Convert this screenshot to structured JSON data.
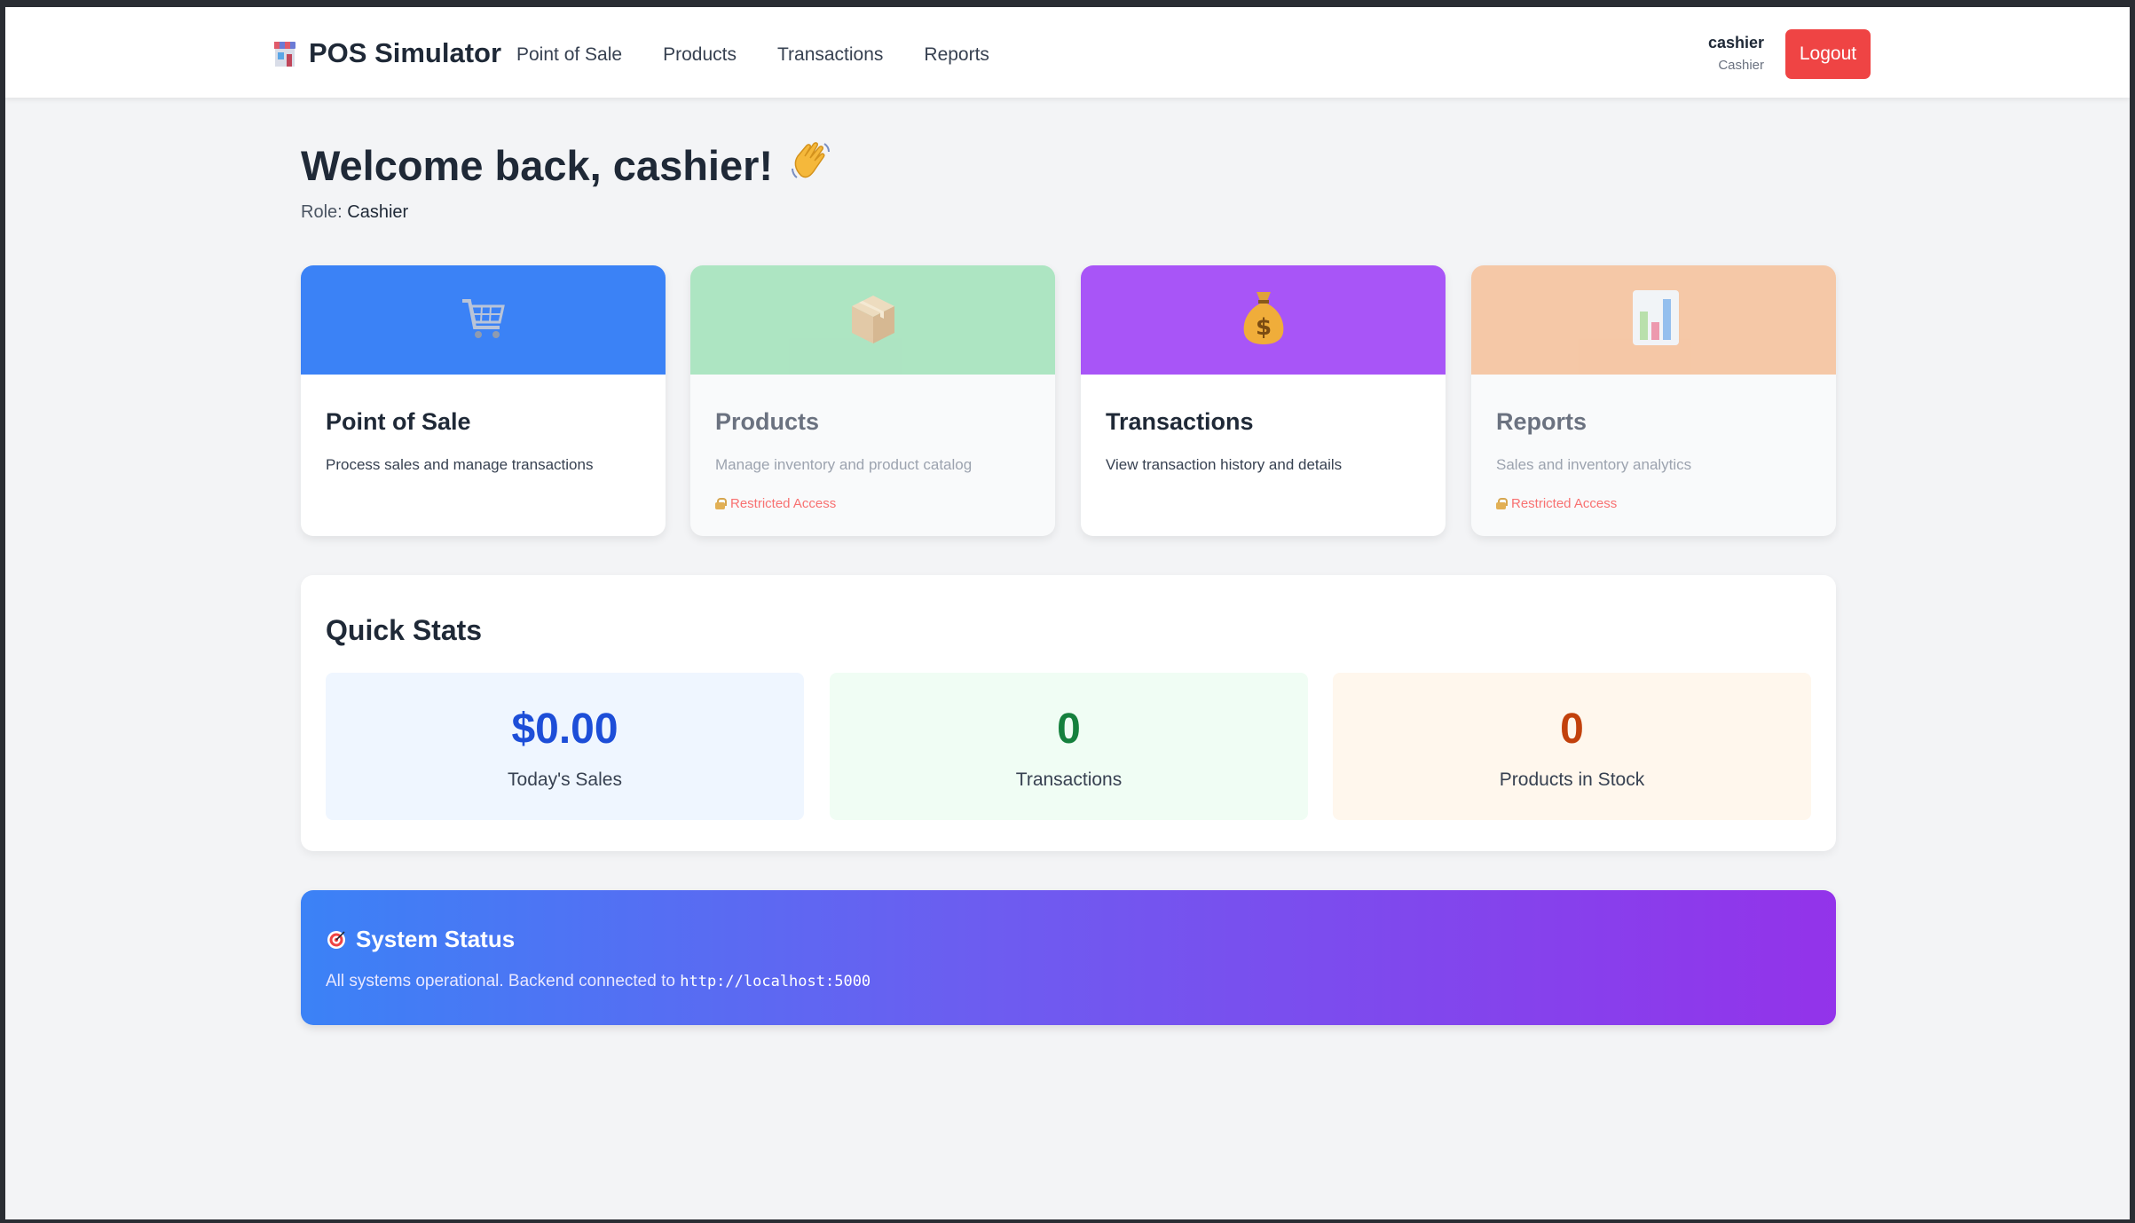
{
  "navbar": {
    "brand_icon": "store-icon",
    "brand": "POS Simulator",
    "links": [
      "Point of Sale",
      "Products",
      "Transactions",
      "Reports"
    ],
    "user_name": "cashier",
    "user_role": "Cashier",
    "logout_label": "Logout"
  },
  "header": {
    "welcome": "Welcome back, cashier!",
    "welcome_icon": "waving-hand-icon",
    "role_label": "Role:",
    "role_value": "Cashier"
  },
  "cards": [
    {
      "title": "Point of Sale",
      "description": "Process sales and manage transactions",
      "icon": "shopping-cart-icon",
      "color": "#3b82f6",
      "restricted": false,
      "restricted_label": ""
    },
    {
      "title": "Products",
      "description": "Manage inventory and product catalog",
      "icon": "package-icon",
      "color": "#8ddcaa",
      "restricted": true,
      "restricted_label": "Restricted Access"
    },
    {
      "title": "Transactions",
      "description": "View transaction history and details",
      "icon": "money-bag-icon",
      "color": "#a855f7",
      "restricted": false,
      "restricted_label": ""
    },
    {
      "title": "Reports",
      "description": "Sales and inventory analytics",
      "icon": "bar-chart-icon",
      "color": "#f4b283",
      "restricted": true,
      "restricted_label": "Restricted Access"
    }
  ],
  "quick_stats": {
    "title": "Quick Stats",
    "items": [
      {
        "value": "$0.00",
        "label": "Today's Sales",
        "color": "#1d4ed8",
        "bg": "#eff6ff"
      },
      {
        "value": "0",
        "label": "Transactions",
        "color": "#15803d",
        "bg": "#f0fdf4"
      },
      {
        "value": "0",
        "label": "Products in Stock",
        "color": "#c2410c",
        "bg": "#fff7ed"
      }
    ]
  },
  "system_status": {
    "icon": "target-icon",
    "title": "System Status",
    "text": "All systems operational. Backend connected to",
    "url": "http://localhost:5000"
  }
}
